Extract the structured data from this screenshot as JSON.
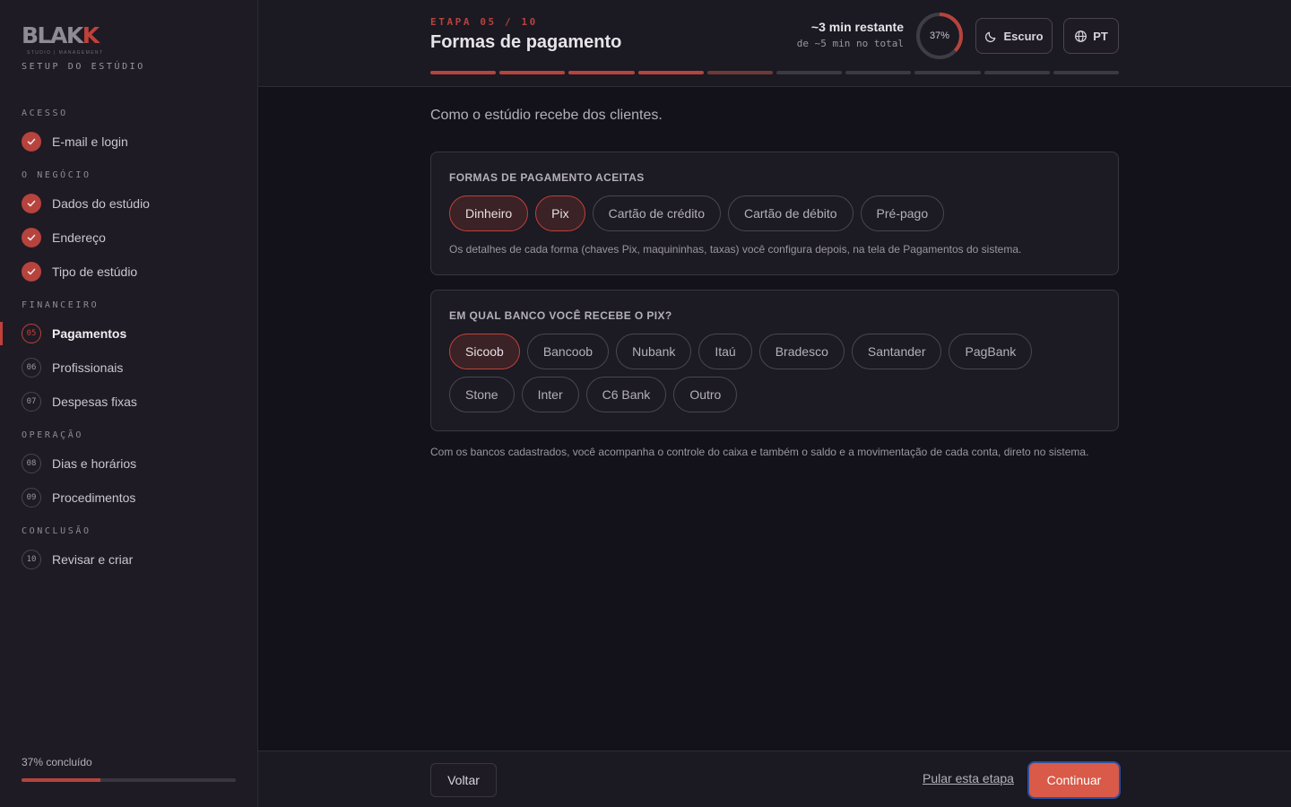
{
  "brand": {
    "logo_text_main": "BLAK",
    "logo_text_accent": "K",
    "logo_tagline": "STUDIO | MANAGEMENT",
    "setup_label": "SETUP DO ESTÚDIO",
    "accent_color": "#c0413a"
  },
  "sidebar": {
    "sections": [
      {
        "label": "ACESSO"
      },
      {
        "label": "O NEGÓCIO"
      },
      {
        "label": "FINANCEIRO"
      },
      {
        "label": "OPERAÇÃO"
      },
      {
        "label": "CONCLUSÃO"
      }
    ],
    "items": [
      {
        "label": "E-mail e login",
        "state": "done",
        "icon": "check-icon"
      },
      {
        "label": "Dados do estúdio",
        "state": "done",
        "icon": "check-icon"
      },
      {
        "label": "Endereço",
        "state": "done",
        "icon": "check-icon"
      },
      {
        "label": "Tipo de estúdio",
        "state": "done",
        "icon": "check-icon"
      },
      {
        "label": "Pagamentos",
        "state": "active",
        "number": "05"
      },
      {
        "label": "Profissionais",
        "state": "pending",
        "number": "06"
      },
      {
        "label": "Despesas fixas",
        "state": "pending",
        "number": "07"
      },
      {
        "label": "Dias e horários",
        "state": "pending",
        "number": "08"
      },
      {
        "label": "Procedimentos",
        "state": "pending",
        "number": "09"
      },
      {
        "label": "Revisar e criar",
        "state": "pending",
        "number": "10"
      }
    ],
    "progress_label": "37% concluído",
    "progress_value": 0.37
  },
  "header": {
    "step_kicker": "ETAPA 05 / 10",
    "title": "Formas de pagamento",
    "time_remaining": "~3 min restante",
    "time_total": "de ~5 min no total",
    "ring_percent": "37%",
    "ring_value": 0.37,
    "theme_button": "Escuro",
    "language_button": "PT",
    "steps_total": 10,
    "steps_done": 4,
    "current_step": 5
  },
  "main": {
    "intro": "Como o estúdio recebe dos clientes.",
    "payment_methods": {
      "title": "FORMAS DE PAGAMENTO ACEITAS",
      "options": [
        {
          "label": "Dinheiro",
          "selected": true
        },
        {
          "label": "Pix",
          "selected": true
        },
        {
          "label": "Cartão de crédito",
          "selected": false
        },
        {
          "label": "Cartão de débito",
          "selected": false
        },
        {
          "label": "Pré-pago",
          "selected": false
        }
      ],
      "note": "Os detalhes de cada forma (chaves Pix, maquininhas, taxas) você configura depois, na tela de Pagamentos do sistema."
    },
    "pix_bank": {
      "title": "EM QUAL BANCO VOCÊ RECEBE O PIX?",
      "options": [
        {
          "label": "Sicoob",
          "selected": true
        },
        {
          "label": "Bancoob",
          "selected": false
        },
        {
          "label": "Nubank",
          "selected": false
        },
        {
          "label": "Itaú",
          "selected": false
        },
        {
          "label": "Bradesco",
          "selected": false
        },
        {
          "label": "Santander",
          "selected": false
        },
        {
          "label": "PagBank",
          "selected": false
        },
        {
          "label": "Stone",
          "selected": false
        },
        {
          "label": "Inter",
          "selected": false
        },
        {
          "label": "C6 Bank",
          "selected": false
        },
        {
          "label": "Outro",
          "selected": false
        }
      ]
    },
    "footnote": "Com os bancos cadastrados, você acompanha o controle do caixa e também o saldo e a movimentação de cada conta, direto no sistema."
  },
  "footer": {
    "back_label": "Voltar",
    "skip_label": "Pular esta etapa",
    "continue_label": "Continuar"
  }
}
